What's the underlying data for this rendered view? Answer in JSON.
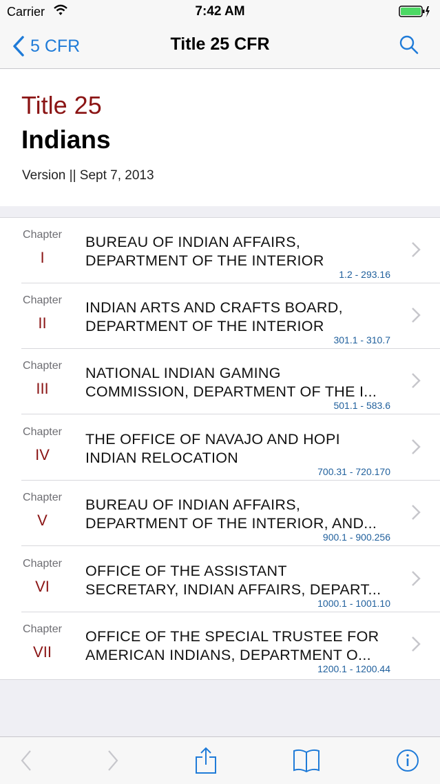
{
  "status": {
    "carrier": "Carrier",
    "time": "7:42 AM"
  },
  "nav": {
    "back_label": "5 CFR",
    "title": "Title 25 CFR"
  },
  "header": {
    "title_number": "Title 25",
    "title_name": "Indians",
    "version": "Version || Sept 7, 2013"
  },
  "chapters": [
    {
      "label": "Chapter",
      "num": "I",
      "line1": "BUREAU OF INDIAN AFFAIRS,",
      "line2": "DEPARTMENT OF THE INTERIOR",
      "range": "1.2 - 293.16"
    },
    {
      "label": "Chapter",
      "num": "II",
      "line1": "INDIAN ARTS AND CRAFTS BOARD,",
      "line2": "DEPARTMENT OF THE INTERIOR",
      "range": "301.1 - 310.7"
    },
    {
      "label": "Chapter",
      "num": "III",
      "line1": "NATIONAL INDIAN GAMING",
      "line2": "COMMISSION, DEPARTMENT OF THE I...",
      "range": "501.1 - 583.6"
    },
    {
      "label": "Chapter",
      "num": "IV",
      "line1": "THE OFFICE OF NAVAJO AND HOPI",
      "line2": "INDIAN RELOCATION",
      "range": "700.31 - 720.170"
    },
    {
      "label": "Chapter",
      "num": "V",
      "line1": "BUREAU OF INDIAN AFFAIRS,",
      "line2": "DEPARTMENT OF THE INTERIOR, AND...",
      "range": "900.1 - 900.256"
    },
    {
      "label": "Chapter",
      "num": "VI",
      "line1": "OFFICE OF THE ASSISTANT",
      "line2": "SECRETARY, INDIAN AFFAIRS, DEPART...",
      "range": "1000.1 - 1001.10"
    },
    {
      "label": "Chapter",
      "num": "VII",
      "line1": "OFFICE OF THE SPECIAL TRUSTEE FOR",
      "line2": "AMERICAN INDIANS, DEPARTMENT O...",
      "range": "1200.1 - 1200.44"
    }
  ],
  "toolbar": {
    "icons": [
      "chevron-left-icon",
      "chevron-right-icon",
      "share-icon",
      "book-icon",
      "info-icon"
    ]
  },
  "colors": {
    "accent": "#1f7bd8",
    "title_red": "#8b1515",
    "range_blue": "#1f5f9c"
  }
}
